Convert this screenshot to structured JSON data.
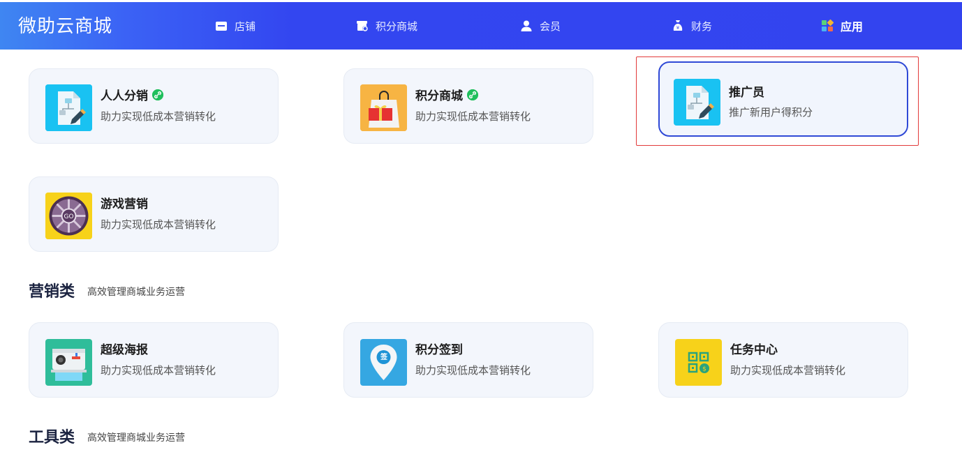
{
  "brand": "微助云商城",
  "nav": [
    {
      "label": "店铺",
      "icon": "store-icon"
    },
    {
      "label": "积分商城",
      "icon": "points-mall-icon"
    },
    {
      "label": "会员",
      "icon": "user-icon"
    },
    {
      "label": "财务",
      "icon": "money-bag-icon"
    },
    {
      "label": "应用",
      "icon": "apps-icon",
      "active": true
    }
  ],
  "cards": [
    {
      "title": "人人分销",
      "desc": "助力实现低成本营销转化",
      "icon": "flowchart-pencil-icon",
      "linked": true
    },
    {
      "title": "积分商城",
      "desc": "助力实现低成本营销转化",
      "icon": "shopping-bag-icon",
      "linked": true
    },
    {
      "title": "推广员",
      "desc": "推广新用户得积分",
      "icon": "flowchart-pencil-icon",
      "selected": true
    },
    {
      "title": "游戏营销",
      "desc": "助力实现低成本营销转化",
      "icon": "roulette-wheel-icon"
    }
  ],
  "sections": [
    {
      "title": "营销类",
      "subtitle": "高效管理商城业务运营",
      "cards": [
        {
          "title": "超级海报",
          "desc": "助力实现低成本营销转化",
          "icon": "camera-poster-icon"
        },
        {
          "title": "积分签到",
          "desc": "助力实现低成本营销转化",
          "icon": "checkin-pin-icon",
          "pin_text": "签"
        },
        {
          "title": "任务中心",
          "desc": "助力实现低成本营销转化",
          "icon": "qr-task-icon"
        }
      ]
    },
    {
      "title": "工具类",
      "subtitle": "高效管理商城业务运营"
    }
  ],
  "colors": {
    "header_blue": "#3346f0",
    "selected_border": "#2f49d6",
    "select_frame": "#e23a3a",
    "link_badge": "#1fbf5c"
  }
}
